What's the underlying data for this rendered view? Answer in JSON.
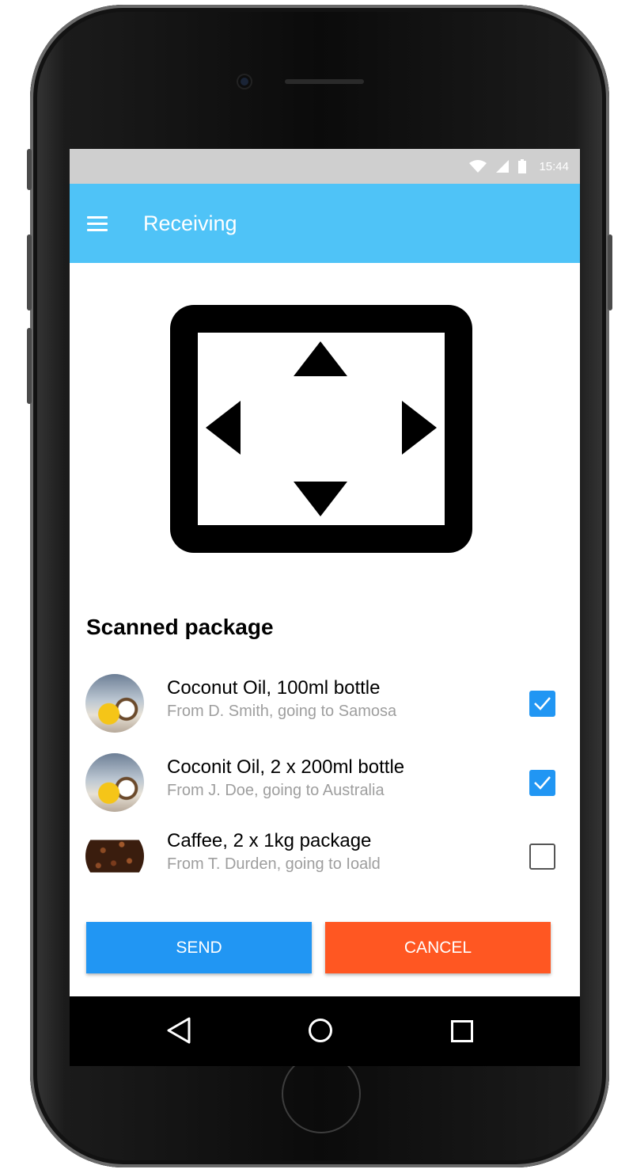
{
  "status_bar": {
    "time": "15:44",
    "icons": [
      "wifi-icon",
      "signal-icon",
      "battery-icon"
    ]
  },
  "app_bar": {
    "title": "Receiving",
    "menu_icon": "menu-icon",
    "color": "#4fc3f7"
  },
  "scanner": {
    "icon": "scan-frame-icon"
  },
  "list": {
    "heading": "Scanned package",
    "items": [
      {
        "title": "Coconut Oil, 100ml bottle",
        "subtitle": "From D. Smith, going to Samosa",
        "checked": true
      },
      {
        "title": "Coconit Oil, 2 x 200ml bottle",
        "subtitle": "From J. Doe, going to Australia",
        "checked": true
      },
      {
        "title": "Caffee, 2 x 1kg package",
        "subtitle": "From T. Durden, going to Ioald",
        "checked": false
      }
    ]
  },
  "actions": {
    "send_label": "SEND",
    "cancel_label": "CANCEL",
    "send_color": "#2196f3",
    "cancel_color": "#ff5722"
  },
  "nav_bar": {
    "icons": [
      "back-icon",
      "home-icon",
      "recent-apps-icon"
    ]
  }
}
